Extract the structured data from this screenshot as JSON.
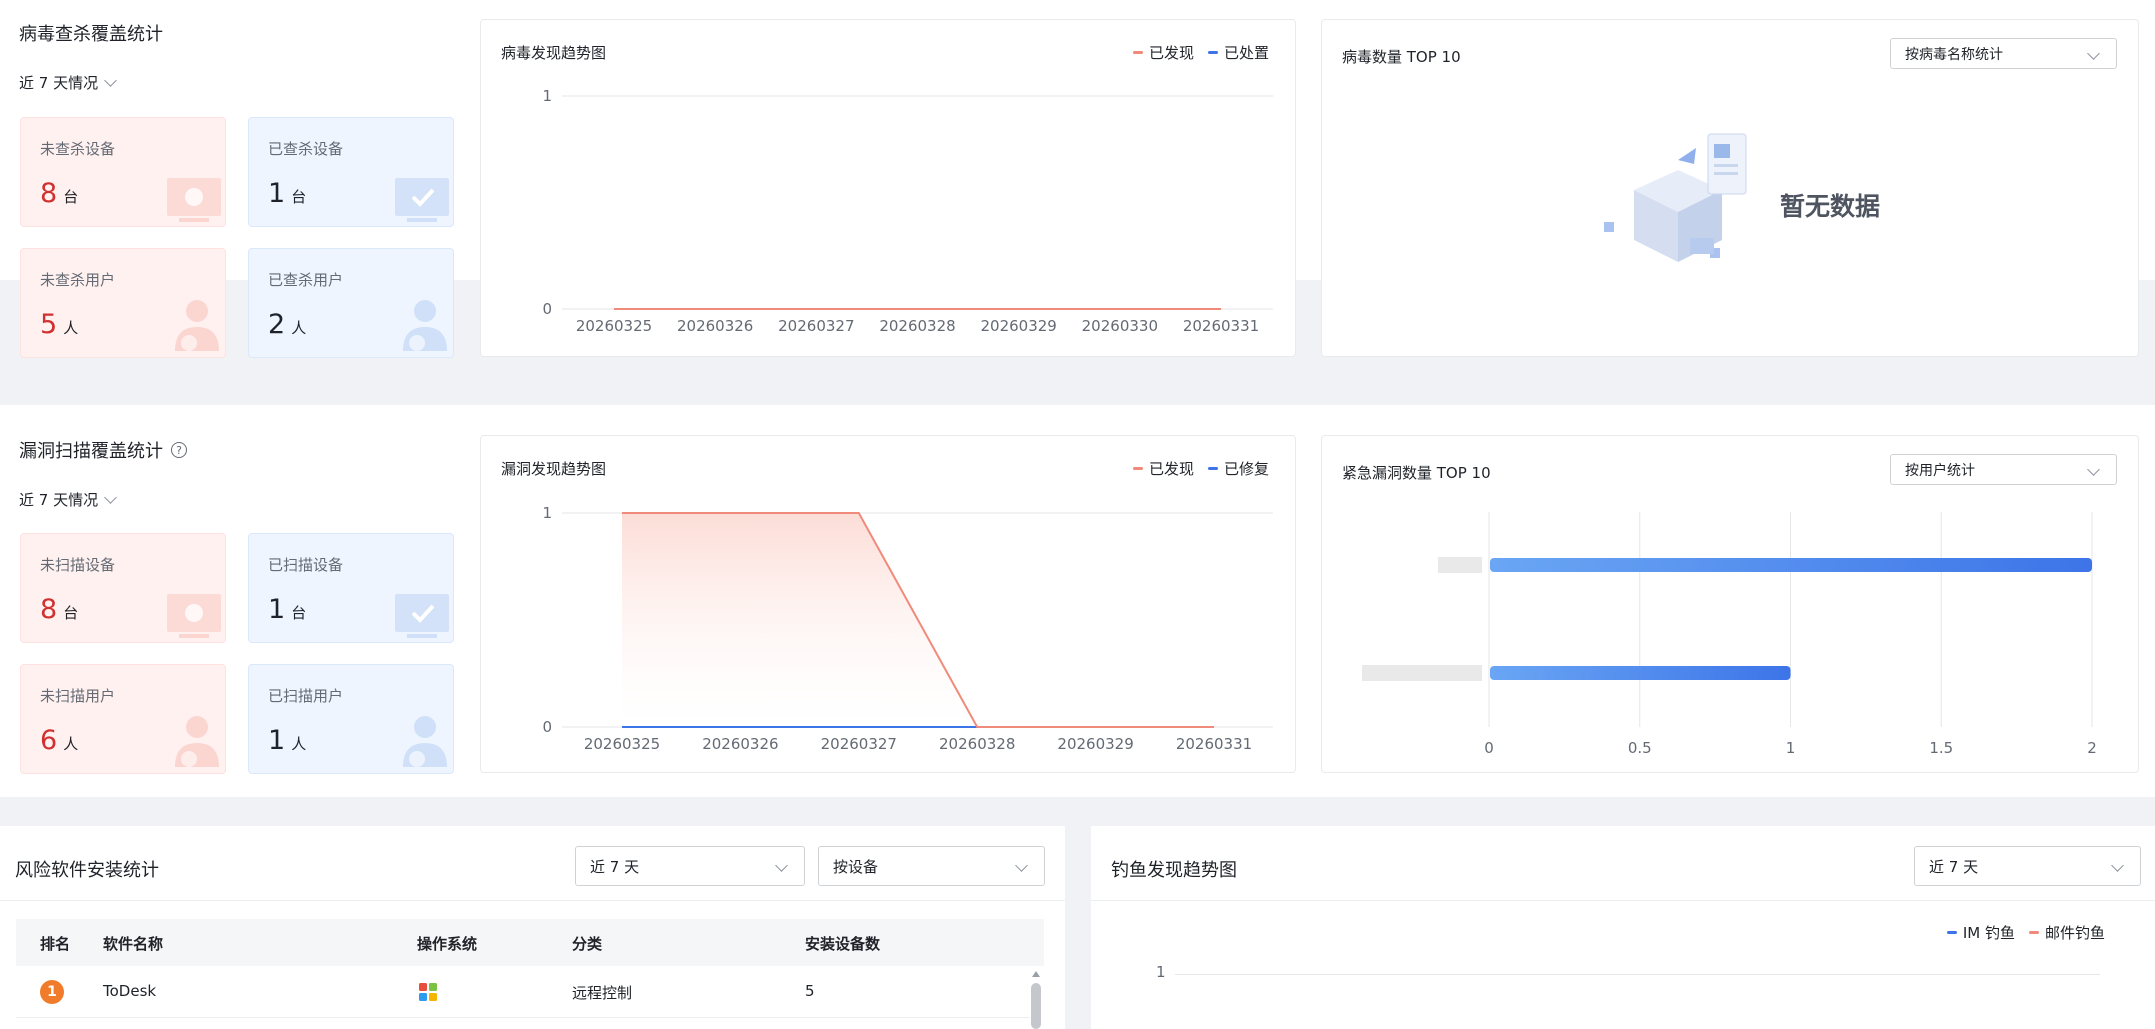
{
  "virus": {
    "title": "病毒查杀覆盖统计",
    "period": "近 7 天情况",
    "stats": [
      {
        "label": "未查杀设备",
        "value": "8",
        "unit": "台"
      },
      {
        "label": "已查杀设备",
        "value": "1",
        "unit": "台"
      },
      {
        "label": "未查杀用户",
        "value": "5",
        "unit": "人"
      },
      {
        "label": "已查杀用户",
        "value": "2",
        "unit": "人"
      }
    ],
    "trend": {
      "title": "病毒发现趋势图",
      "legend": [
        "已发现",
        "已处置"
      ]
    },
    "top10": {
      "title": "病毒数量 TOP 10",
      "select": "按病毒名称统计",
      "empty": "暂无数据"
    }
  },
  "vuln": {
    "title": "漏洞扫描覆盖统计",
    "period": "近 7 天情况",
    "stats": [
      {
        "label": "未扫描设备",
        "value": "8",
        "unit": "台"
      },
      {
        "label": "已扫描设备",
        "value": "1",
        "unit": "台"
      },
      {
        "label": "未扫描用户",
        "value": "6",
        "unit": "人"
      },
      {
        "label": "已扫描用户",
        "value": "1",
        "unit": "人"
      }
    ],
    "trend": {
      "title": "漏洞发现趋势图",
      "legend": [
        "已发现",
        "已修复"
      ]
    },
    "top10": {
      "title": "紧急漏洞数量 TOP 10",
      "select": "按用户统计"
    }
  },
  "risk": {
    "title": "风险软件安装统计",
    "period_select": "近 7 天",
    "group_select": "按设备",
    "columns": [
      "排名",
      "软件名称",
      "操作系统",
      "分类",
      "安装设备数"
    ],
    "rows": [
      {
        "rank": "1",
        "name": "ToDesk",
        "os": "windows",
        "category": "远程控制",
        "count": "5"
      }
    ]
  },
  "phish": {
    "title": "钓鱼发现趋势图",
    "period_select": "近 7 天",
    "legend": [
      "IM 钓鱼",
      "邮件钓鱼"
    ],
    "y_tick": "1"
  },
  "colors": {
    "red": "#f08a7a",
    "blue": "#3d74e8",
    "stat_red": "#d0302f"
  },
  "chart_data": [
    {
      "type": "line",
      "title": "病毒发现趋势图",
      "x": [
        "20260325",
        "20260326",
        "20260327",
        "20260328",
        "20260329",
        "20260330",
        "20260331"
      ],
      "series": [
        {
          "name": "已发现",
          "values": [
            0,
            0,
            0,
            0,
            0,
            0,
            0
          ]
        },
        {
          "name": "已处置",
          "values": [
            0,
            0,
            0,
            0,
            0,
            0,
            0
          ]
        }
      ],
      "y_ticks": [
        "0",
        "1"
      ],
      "ylim": [
        0,
        1
      ]
    },
    {
      "type": "area",
      "title": "漏洞发现趋势图",
      "x": [
        "20260325",
        "20260326",
        "20260327",
        "20260328",
        "20260329",
        "20260331"
      ],
      "series": [
        {
          "name": "已发现",
          "values": [
            1,
            1,
            1,
            0,
            0,
            0
          ]
        },
        {
          "name": "已修复",
          "values": [
            0,
            0,
            0,
            0,
            0,
            0
          ]
        }
      ],
      "y_ticks": [
        "0",
        "1"
      ],
      "ylim": [
        0,
        1
      ]
    },
    {
      "type": "bar",
      "title": "紧急漏洞数量 TOP 10",
      "orientation": "horizontal",
      "categories": [
        "",
        ""
      ],
      "values": [
        2,
        1
      ],
      "x_ticks": [
        "0",
        "0.5",
        "1",
        "1.5",
        "2"
      ],
      "xlim": [
        0,
        2
      ]
    }
  ]
}
